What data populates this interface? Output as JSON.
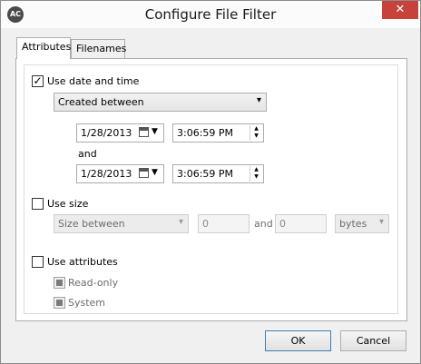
{
  "window": {
    "title": "Configure File Filter",
    "app_icon_text": "AC",
    "close_label": "✕"
  },
  "tabs": [
    {
      "label": "Attributes",
      "active": true
    },
    {
      "label": "Filenames",
      "active": false
    }
  ],
  "date_section": {
    "use_label": "Use date and time",
    "checked": true,
    "mode_value": "Created between",
    "from_date": "1/28/2013",
    "from_time": "3:06:59 PM",
    "and_label": "and",
    "to_date": "1/28/2013",
    "to_time": "3:06:59 PM"
  },
  "size_section": {
    "use_label": "Use size",
    "checked": false,
    "mode_value": "Size between",
    "min_value": "0",
    "and_label": "and",
    "max_value": "0",
    "unit_value": "bytes"
  },
  "attributes_section": {
    "use_label": "Use attributes",
    "checked": false,
    "options": [
      {
        "label": "Read-only"
      },
      {
        "label": "System"
      }
    ]
  },
  "footer": {
    "ok_label": "OK",
    "cancel_label": "Cancel"
  },
  "colors": {
    "close_button": "#c7423a",
    "dialog_background": "#f0f0f0",
    "panel_background": "#ffffff"
  }
}
